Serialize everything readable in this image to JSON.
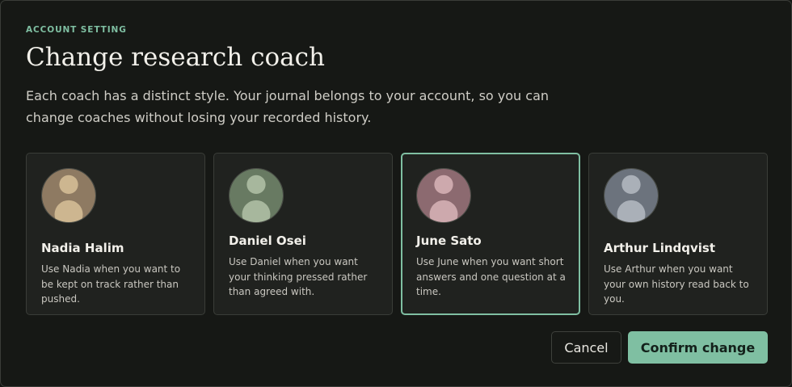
{
  "dialog": {
    "eyebrow": "ACCOUNT SETTING",
    "title": "Change research coach",
    "description": "Each coach has a distinct style. Your journal belongs to your account, so you can change coaches without losing your recorded history."
  },
  "coaches": [
    {
      "name": "Nadia Halim",
      "description": "Use Nadia when you want to be kept on track rather than pushed.",
      "avatar_color": "#8e7a62",
      "figure_color": "#cdb690",
      "selected": false
    },
    {
      "name": "Daniel Osei",
      "description": "Use Daniel when you want your thinking pressed rather than agreed with.",
      "avatar_color": "#687a62",
      "figure_color": "#a7b79d",
      "selected": false
    },
    {
      "name": "June Sato",
      "description": "Use June when you want short answers and one question at a time.",
      "avatar_color": "#8c6a70",
      "figure_color": "#cda9ad",
      "selected": true
    },
    {
      "name": "Arthur Lindqvist",
      "description": "Use Arthur when you want your own history read back to you.",
      "avatar_color": "#6c737d",
      "figure_color": "#aab0b8",
      "selected": false
    }
  ],
  "actions": {
    "cancel_label": "Cancel",
    "confirm_label": "Confirm change"
  },
  "colors": {
    "accent": "#7fbfa2",
    "background": "#161815",
    "card": "#20221f"
  }
}
